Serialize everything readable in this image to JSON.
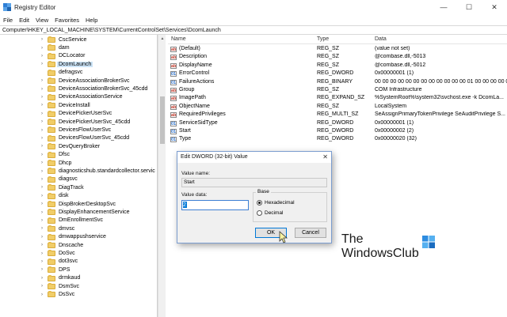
{
  "window": {
    "title": "Registry Editor",
    "minimize": "—",
    "maximize": "☐",
    "close": "✕"
  },
  "menu": [
    "File",
    "Edit",
    "View",
    "Favorites",
    "Help"
  ],
  "address": "Computer\\HKEY_LOCAL_MACHINE\\SYSTEM\\CurrentControlSet\\Services\\DcomLaunch",
  "tree": {
    "items": [
      {
        "label": "CscService",
        "chevron": "›"
      },
      {
        "label": "dam",
        "chevron": "›"
      },
      {
        "label": "DCLocator",
        "chevron": "›"
      },
      {
        "label": "DcomLaunch",
        "chevron": "›",
        "selected": true
      },
      {
        "label": "defragsvc",
        "chevron": ""
      },
      {
        "label": "DeviceAssociationBrokerSvc",
        "chevron": "›"
      },
      {
        "label": "DeviceAssociationBrokerSvc_45cdd",
        "chevron": "›"
      },
      {
        "label": "DeviceAssociationService",
        "chevron": "›"
      },
      {
        "label": "DeviceInstall",
        "chevron": "›"
      },
      {
        "label": "DevicePickerUserSvc",
        "chevron": "›"
      },
      {
        "label": "DevicePickerUserSvc_45cdd",
        "chevron": "›"
      },
      {
        "label": "DevicesFlowUserSvc",
        "chevron": "›"
      },
      {
        "label": "DevicesFlowUserSvc_45cdd",
        "chevron": "›"
      },
      {
        "label": "DevQueryBroker",
        "chevron": "›"
      },
      {
        "label": "Dfsc",
        "chevron": "›"
      },
      {
        "label": "Dhcp",
        "chevron": "›"
      },
      {
        "label": "diagnosticshub.standardcollector.servic",
        "chevron": "›"
      },
      {
        "label": "diagsvc",
        "chevron": "›"
      },
      {
        "label": "DiagTrack",
        "chevron": "›"
      },
      {
        "label": "disk",
        "chevron": "›"
      },
      {
        "label": "DispBrokerDesktopSvc",
        "chevron": "›"
      },
      {
        "label": "DisplayEnhancementService",
        "chevron": "›"
      },
      {
        "label": "DmEnrollmentSvc",
        "chevron": "›"
      },
      {
        "label": "dmvsc",
        "chevron": "›"
      },
      {
        "label": "dmwappushservice",
        "chevron": "›"
      },
      {
        "label": "Dnscache",
        "chevron": "›"
      },
      {
        "label": "DoSvc",
        "chevron": "›"
      },
      {
        "label": "dot3svc",
        "chevron": "›"
      },
      {
        "label": "DPS",
        "chevron": "›"
      },
      {
        "label": "drmkaud",
        "chevron": "›"
      },
      {
        "label": "DsmSvc",
        "chevron": "›"
      },
      {
        "label": "DsSvc",
        "chevron": "›"
      }
    ]
  },
  "values": {
    "headers": {
      "name": "Name",
      "type": "Type",
      "data": "Data"
    },
    "rows": [
      {
        "icon": "ab",
        "kind": "sz",
        "name": "(Default)",
        "type": "REG_SZ",
        "data": "(value not set)"
      },
      {
        "icon": "ab",
        "kind": "sz",
        "name": "Description",
        "type": "REG_SZ",
        "data": "@combase.dll,-5013"
      },
      {
        "icon": "ab",
        "kind": "sz",
        "name": "DisplayName",
        "type": "REG_SZ",
        "data": "@combase.dll,-5012"
      },
      {
        "icon": "01",
        "kind": "bin",
        "name": "ErrorControl",
        "type": "REG_DWORD",
        "data": "0x00000001 (1)"
      },
      {
        "icon": "01",
        "kind": "bin",
        "name": "FailureActions",
        "type": "REG_BINARY",
        "data": "00 00 00 00 00 00 00 00 00 00 00 00 01 00 00 00 00 00..."
      },
      {
        "icon": "ab",
        "kind": "sz",
        "name": "Group",
        "type": "REG_SZ",
        "data": "COM Infrastructure"
      },
      {
        "icon": "ab",
        "kind": "sz",
        "name": "ImagePath",
        "type": "REG_EXPAND_SZ",
        "data": "%SystemRoot%\\system32\\svchost.exe -k DcomLa..."
      },
      {
        "icon": "ab",
        "kind": "sz",
        "name": "ObjectName",
        "type": "REG_SZ",
        "data": "LocalSystem"
      },
      {
        "icon": "ab",
        "kind": "sz",
        "name": "RequiredPrivileges",
        "type": "REG_MULTI_SZ",
        "data": "SeAssignPrimaryTokenPrivilege SeAuditPrivilege S..."
      },
      {
        "icon": "01",
        "kind": "bin",
        "name": "ServiceSidType",
        "type": "REG_DWORD",
        "data": "0x00000001 (1)"
      },
      {
        "icon": "01",
        "kind": "bin",
        "name": "Start",
        "type": "REG_DWORD",
        "data": "0x00000002 (2)"
      },
      {
        "icon": "01",
        "kind": "bin",
        "name": "Type",
        "type": "REG_DWORD",
        "data": "0x00000020 (32)"
      }
    ]
  },
  "dialog": {
    "title": "Edit DWORD (32-bit) Value",
    "close": "✕",
    "value_name_label": "Value name:",
    "value_name": "Start",
    "value_data_label": "Value data:",
    "value_data": "2",
    "base_label": "Base",
    "hex_label": "Hexadecimal",
    "dec_label": "Decimal",
    "selected_base": "Hexadecimal",
    "ok": "OK",
    "cancel": "Cancel"
  },
  "watermark": {
    "line1": "The",
    "line2": "WindowsClub"
  },
  "colors": {
    "selection": "#cce4f7",
    "accent": "#0078d7",
    "folder": "#f1cd68"
  }
}
